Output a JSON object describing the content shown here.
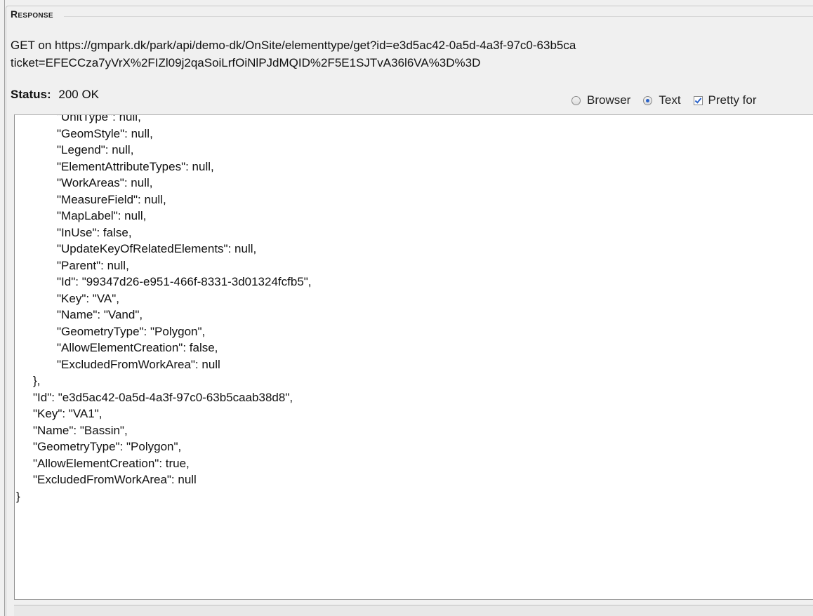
{
  "response": {
    "section_title": "Response",
    "request_line_1": "GET on https://gmpark.dk/park/api/demo-dk/OnSite/elementtype/get?id=e3d5ac42-0a5d-4a3f-97c0-63b5ca",
    "request_line_2": "ticket=EFECCza7yVrX%2FIZl09j2qaSoiLrfOiNlPJdMQID%2F5E1SJTvA36l6VA%3D%3D",
    "status_label": "Status:",
    "status_value": "200 OK",
    "options": [
      {
        "label": "Browser",
        "type": "radio",
        "checked": false
      },
      {
        "label": "Text",
        "type": "radio",
        "checked": true
      },
      {
        "label": "Pretty for",
        "type": "checkbox",
        "checked": true
      }
    ],
    "body_lines": [
      {
        "indent": 2,
        "text": "\"UnitType\": null,"
      },
      {
        "indent": 2,
        "text": "\"GeomStyle\": null,"
      },
      {
        "indent": 2,
        "text": "\"Legend\": null,"
      },
      {
        "indent": 2,
        "text": "\"ElementAttributeTypes\": null,"
      },
      {
        "indent": 2,
        "text": "\"WorkAreas\": null,"
      },
      {
        "indent": 2,
        "text": "\"MeasureField\": null,"
      },
      {
        "indent": 2,
        "text": "\"MapLabel\": null,"
      },
      {
        "indent": 2,
        "text": "\"InUse\": false,"
      },
      {
        "indent": 2,
        "text": "\"UpdateKeyOfRelatedElements\": null,"
      },
      {
        "indent": 2,
        "text": "\"Parent\": null,"
      },
      {
        "indent": 2,
        "text": "\"Id\": \"99347d26-e951-466f-8331-3d01324fcfb5\","
      },
      {
        "indent": 2,
        "text": "\"Key\": \"VA\","
      },
      {
        "indent": 2,
        "text": "\"Name\": \"Vand\","
      },
      {
        "indent": 2,
        "text": "\"GeometryType\": \"Polygon\","
      },
      {
        "indent": 2,
        "text": "\"AllowElementCreation\": false,"
      },
      {
        "indent": 2,
        "text": "\"ExcludedFromWorkArea\": null"
      },
      {
        "indent": 1,
        "text": "},"
      },
      {
        "indent": 1,
        "text": "\"Id\": \"e3d5ac42-0a5d-4a3f-97c0-63b5caab38d8\","
      },
      {
        "indent": 1,
        "text": "\"Key\": \"VA1\","
      },
      {
        "indent": 1,
        "text": "\"Name\": \"Bassin\","
      },
      {
        "indent": 1,
        "text": "\"GeometryType\": \"Polygon\","
      },
      {
        "indent": 1,
        "text": "\"AllowElementCreation\": true,"
      },
      {
        "indent": 1,
        "text": "\"ExcludedFromWorkArea\": null"
      },
      {
        "indent": 0,
        "text": "}"
      }
    ]
  }
}
